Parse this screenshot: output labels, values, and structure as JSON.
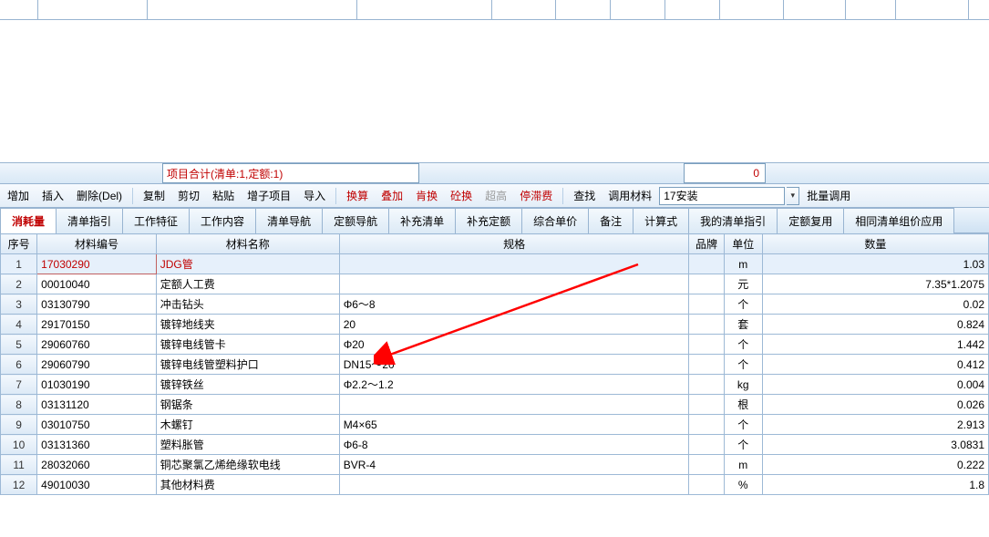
{
  "top_ruler_widths": [
    42,
    120,
    230,
    148,
    70,
    60,
    60,
    60,
    70,
    68,
    55,
    80
  ],
  "summary": {
    "label": "项目合计(清单:1,定额:1)",
    "value": "0"
  },
  "toolbar": {
    "add": "增加",
    "insert": "插入",
    "delete": "删除(Del)",
    "copy": "复制",
    "cut": "剪切",
    "paste": "粘贴",
    "subitem": "增子项目",
    "import": "导入",
    "recalc": "换算",
    "stack": "叠加",
    "swap": "肯换",
    "concrete": "砼换",
    "ultra": "超高",
    "stopfee": "停滞费",
    "find": "查找",
    "material": "调用材料",
    "select_value": "17安装",
    "batch": "批量调用"
  },
  "tabs": [
    "消耗量",
    "清单指引",
    "工作特征",
    "工作内容",
    "清单导航",
    "定额导航",
    "补充清单",
    "补充定额",
    "综合单价",
    "备注",
    "计算式",
    "我的清单指引",
    "定额复用",
    "相同清单组价应用"
  ],
  "active_tab": 0,
  "headers": {
    "seq": "序号",
    "code": "材料编号",
    "name": "材料名称",
    "spec": "规格",
    "brand": "品牌",
    "unit": "单位",
    "qty": "数量"
  },
  "rows": [
    {
      "seq": "1",
      "code": "17030290",
      "name": "JDG管",
      "spec": "",
      "brand": "",
      "unit": "m",
      "qty": "1.03",
      "selected": true
    },
    {
      "seq": "2",
      "code": "00010040",
      "name": "定额人工费",
      "spec": "",
      "brand": "",
      "unit": "元",
      "qty": "7.35*1.2075"
    },
    {
      "seq": "3",
      "code": "03130790",
      "name": "冲击钻头",
      "spec": "Φ6～8",
      "brand": "",
      "unit": "个",
      "qty": "0.02"
    },
    {
      "seq": "4",
      "code": "29170150",
      "name": "镀锌地线夹",
      "spec": "20",
      "brand": "",
      "unit": "套",
      "qty": "0.824"
    },
    {
      "seq": "5",
      "code": "29060760",
      "name": "镀锌电线管卡",
      "spec": "Φ20",
      "brand": "",
      "unit": "个",
      "qty": "1.442"
    },
    {
      "seq": "6",
      "code": "29060790",
      "name": "镀锌电线管塑料护口",
      "spec": "DN15～20",
      "brand": "",
      "unit": "个",
      "qty": "0.412"
    },
    {
      "seq": "7",
      "code": "01030190",
      "name": "镀锌铁丝",
      "spec": "Φ2.2～1.2",
      "brand": "",
      "unit": "kg",
      "qty": "0.004"
    },
    {
      "seq": "8",
      "code": "03131120",
      "name": "钢锯条",
      "spec": "",
      "brand": "",
      "unit": "根",
      "qty": "0.026"
    },
    {
      "seq": "9",
      "code": "03010750",
      "name": "木螺钉",
      "spec": "M4×65",
      "brand": "",
      "unit": "个",
      "qty": "2.913"
    },
    {
      "seq": "10",
      "code": "03131360",
      "name": "塑料胀管",
      "spec": "Φ6-8",
      "brand": "",
      "unit": "个",
      "qty": "3.0831"
    },
    {
      "seq": "11",
      "code": "28032060",
      "name": "铜芯聚氯乙烯绝缘软电线",
      "spec": "BVR-4",
      "brand": "",
      "unit": "m",
      "qty": "0.222"
    },
    {
      "seq": "12",
      "code": "49010030",
      "name": "其他材料费",
      "spec": "",
      "brand": "",
      "unit": "%",
      "qty": "1.8"
    }
  ]
}
